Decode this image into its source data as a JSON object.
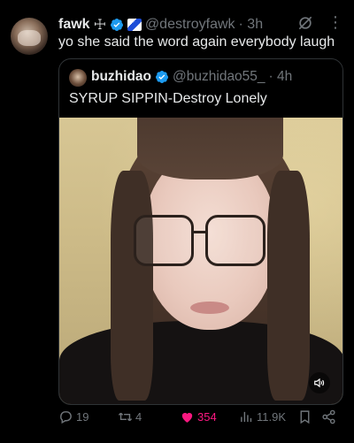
{
  "tweet": {
    "author_name": "fawk",
    "author_cross": "☩",
    "author_handle": "@destroyfawk",
    "time": "· 3h",
    "text": "yo she said the word again everybody laugh"
  },
  "quote": {
    "author_name": "buzhidao",
    "author_handle": "@buzhidao55_",
    "time": "· 4h",
    "text": "SYRUP SIPPIN-Destroy Lonely"
  },
  "actions": {
    "replies": "19",
    "retweets": "4",
    "likes": "354",
    "views": "11.9K"
  },
  "colors": {
    "verified": "#1d9bf0",
    "like": "#f91880",
    "muted": "#71767b"
  },
  "icons": [
    "verified-badge-icon",
    "grok-icon",
    "more-icon",
    "sound-icon",
    "reply-icon",
    "retweet-icon",
    "heart-icon",
    "views-icon",
    "bookmark-icon",
    "share-icon"
  ]
}
